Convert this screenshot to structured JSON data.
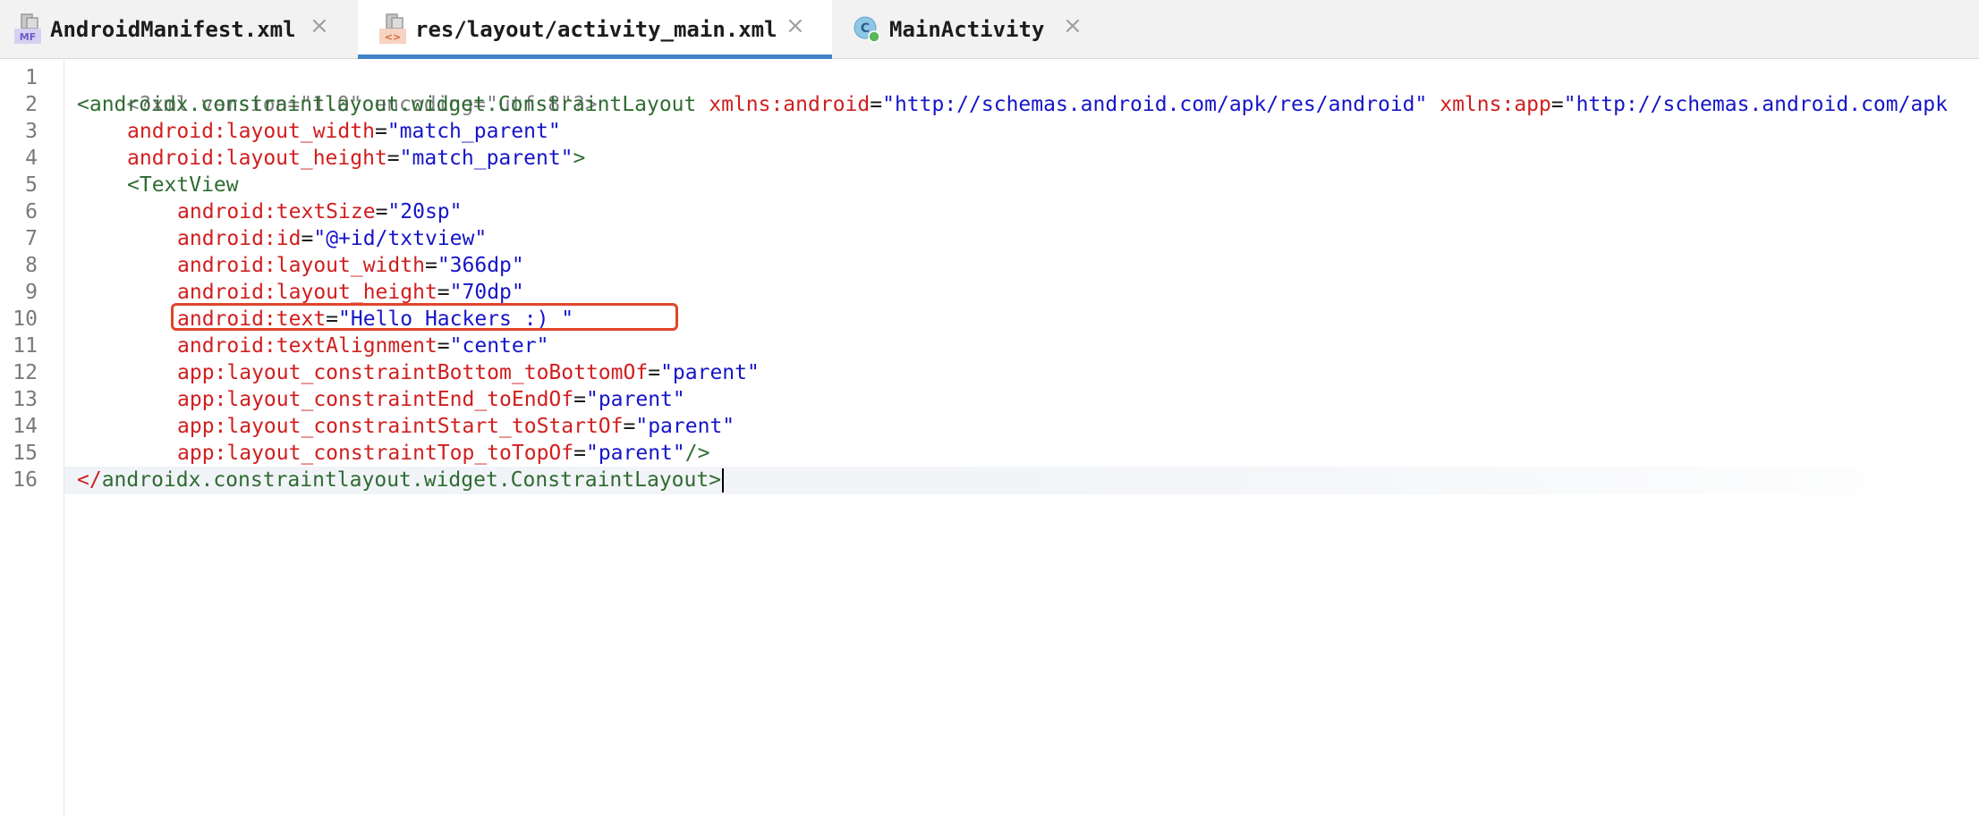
{
  "tabs": [
    {
      "label": "AndroidManifest.xml",
      "icon": "manifest-file-icon",
      "active": false
    },
    {
      "label": "res/layout/activity_main.xml",
      "icon": "layout-xml-file-icon",
      "active": true
    },
    {
      "label": "MainActivity",
      "icon": "kotlin-class-icon",
      "active": false
    }
  ],
  "close_glyph": "×",
  "manifest_icon_text": "MF",
  "layout_icon_text": "<>",
  "class_icon_text": "C",
  "line_numbers": [
    "1",
    "2",
    "3",
    "4",
    "5",
    "6",
    "7",
    "8",
    "9",
    "10",
    "11",
    "12",
    "13",
    "14",
    "15",
    "16"
  ],
  "code": {
    "l1": "<?xml version=\"1.0\" encoding=\"utf-8\"?>",
    "l2_tag": "<androidx.constraintlayout.widget.ConstraintLayout",
    "l2_attr1": "xmlns:android",
    "l2_val1": "\"http://schemas.android.com/apk/res/android\"",
    "l2_attr2": "xmlns:app",
    "l2_val2": "\"http://schemas.android.com/apk",
    "l3_attr": "android:layout_width",
    "l3_val": "\"match_parent\"",
    "l4_attr": "android:layout_height",
    "l4_val": "\"match_parent\"",
    "l4_end": ">",
    "l5_tag": "<TextView",
    "l6_attr": "android:textSize",
    "l6_val": "\"20sp\"",
    "l7_attr": "android:id",
    "l7_val": "\"@+id/txtview\"",
    "l8_attr": "android:layout_width",
    "l8_val": "\"366dp\"",
    "l9_attr": "android:layout_height",
    "l9_val": "\"70dp\"",
    "l10_attr": "android:text",
    "l10_val": "\"Hello Hackers :) \"",
    "l11_attr": "android:textAlignment",
    "l11_val": "\"center\"",
    "l12_attr": "app:layout_constraintBottom_toBottomOf",
    "l12_val": "\"parent\"",
    "l13_attr": "app:layout_constraintEnd_toEndOf",
    "l13_val": "\"parent\"",
    "l14_attr": "app:layout_constraintStart_toStartOf",
    "l14_val": "\"parent\"",
    "l15_attr": "app:layout_constraintTop_toTopOf",
    "l15_val": "\"parent\"",
    "l15_end": "/>",
    "l16_open": "</",
    "l16_tag": "androidx.constraintlayout.widget.ConstraintLayout",
    "l16_end": ">"
  },
  "eq": "=",
  "colors": {
    "tag": "#2f6b32",
    "attribute": "#d11e1e",
    "value": "#1515c9",
    "highlight_box": "#e0452a",
    "active_tab_underline": "#4083c9"
  }
}
